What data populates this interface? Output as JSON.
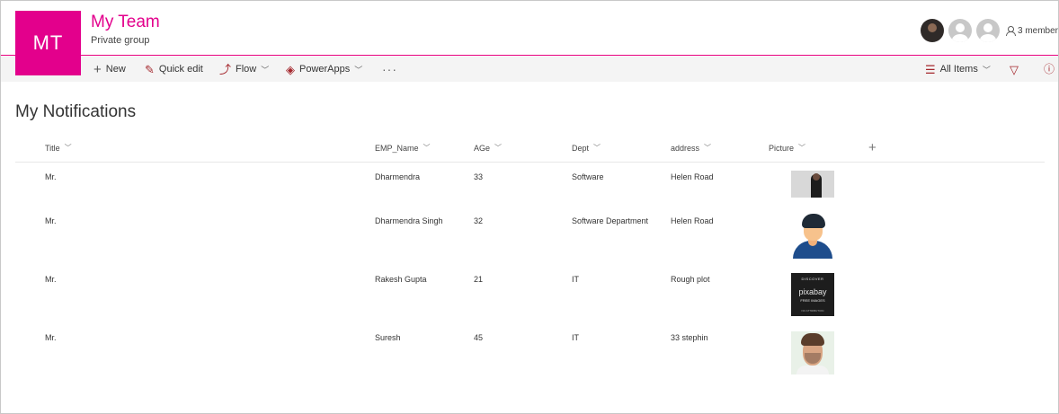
{
  "site": {
    "logo_initials": "MT",
    "title": "My Team",
    "subtitle": "Private group",
    "member_count": "3 member"
  },
  "commands": {
    "new": "New",
    "quick_edit": "Quick edit",
    "flow": "Flow",
    "powerapps": "PowerApps",
    "more": "···",
    "view": "All Items"
  },
  "page": {
    "title": "My Notifications"
  },
  "table": {
    "columns": [
      "Title",
      "EMP_Name",
      "AGe",
      "Dept",
      "address",
      "Picture"
    ],
    "rows": [
      {
        "title": "Mr.",
        "emp_name": "Dharmendra",
        "age": "33",
        "dept": "Software",
        "address": "Helen Road"
      },
      {
        "title": "Mr.",
        "emp_name": "Dharmendra Singh",
        "age": "32",
        "dept": "Software Department",
        "address": "Helen Road"
      },
      {
        "title": "Mr.",
        "emp_name": "Rakesh Gupta",
        "age": "21",
        "dept": "IT",
        "address": "Rough plot"
      },
      {
        "title": "Mr.",
        "emp_name": "Suresh",
        "age": "45",
        "dept": "IT",
        "address": "33 stephin"
      }
    ],
    "pixabay_image": {
      "line1": "DISCOVER",
      "line2": "pixabay",
      "line3": "FREE IMAGES",
      "line4": "NO ATTRIBUTION"
    }
  },
  "colors": {
    "brand": "#e3008c",
    "icon_accent": "#a4262c"
  }
}
